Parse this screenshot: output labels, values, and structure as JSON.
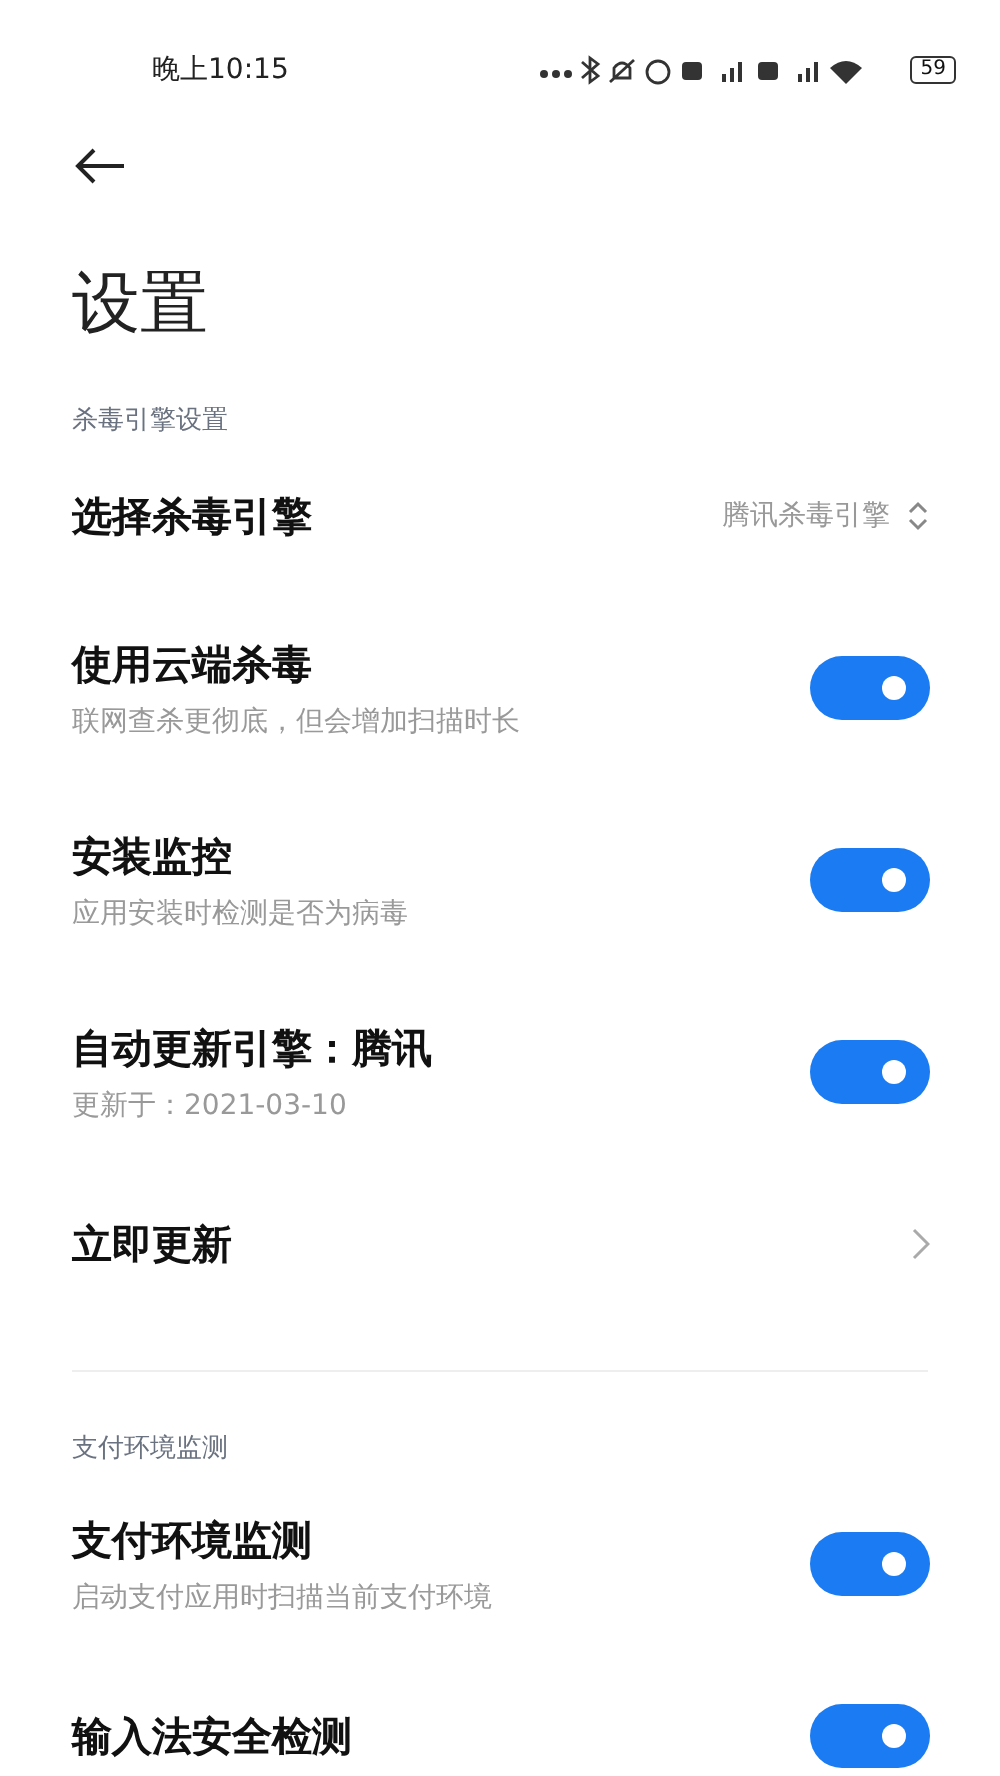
{
  "status_bar": {
    "time": "晚上10:15",
    "battery": "59"
  },
  "title": "设置",
  "sections": [
    {
      "label": "杀毒引擎设置",
      "items": [
        {
          "kind": "select",
          "title": "选择杀毒引擎",
          "value": "腾讯杀毒引擎"
        },
        {
          "kind": "toggle",
          "title": "使用云端杀毒",
          "subtitle": "联网查杀更彻底，但会增加扫描时长",
          "on": true
        },
        {
          "kind": "toggle",
          "title": "安装监控",
          "subtitle": "应用安装时检测是否为病毒",
          "on": true
        },
        {
          "kind": "toggle",
          "title": "自动更新引擎：腾讯",
          "subtitle": "更新于：2021-03-10",
          "on": true
        },
        {
          "kind": "link",
          "title": "立即更新"
        }
      ]
    },
    {
      "label": "支付环境监测",
      "items": [
        {
          "kind": "toggle",
          "title": "支付环境监测",
          "subtitle": "启动支付应用时扫描当前支付环境",
          "on": true
        },
        {
          "kind": "toggle",
          "title": "输入法安全检测",
          "on": true
        }
      ]
    }
  ]
}
